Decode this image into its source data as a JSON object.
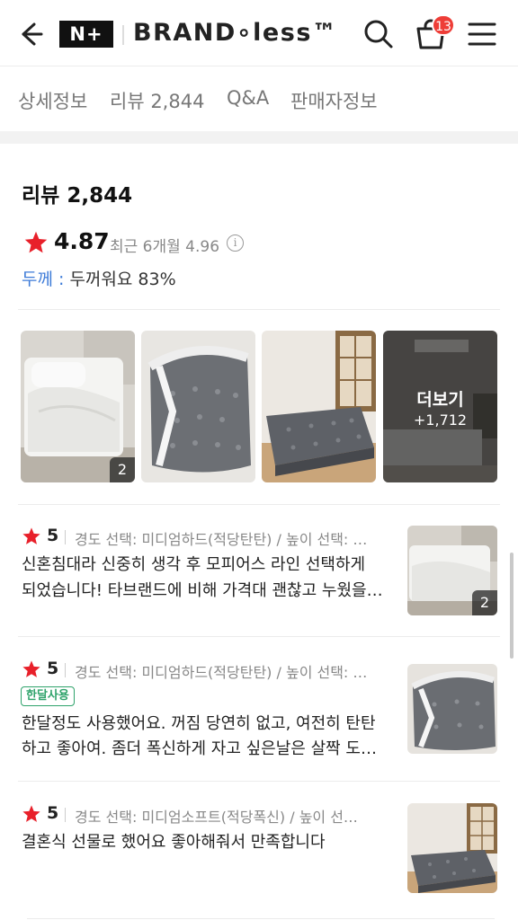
{
  "header": {
    "logo_text": "N+",
    "brand": "BRAND∘less™",
    "cart_count": "13"
  },
  "tabs": [
    "상세정보",
    "리뷰 2,844",
    "Q&A",
    "판매자정보"
  ],
  "summary": {
    "title": "리뷰 2,844",
    "rating": "4.87",
    "recent_label": "최근 6개월 4.96",
    "thickness_key": "두께 :",
    "thickness_value": "두꺼워요 83%",
    "star_color": "#e8202a"
  },
  "photos": [
    {
      "count": "2"
    },
    {
      "count": ""
    },
    {
      "count": ""
    },
    {
      "more_label": "더보기",
      "more_count": "+1,712"
    }
  ],
  "reviews": [
    {
      "score": "5",
      "option": "경도 선택: 미디엄하드(적당탄탄) / 높이 선택: …",
      "badge": "",
      "line1": "신혼침대라 신중히 생각 후 모피어스 라인 선택하게",
      "line2": "되었습니다! 타브랜드에 비해 가격대 괜찮고 누웠을…",
      "thumb_count": "2"
    },
    {
      "score": "5",
      "option": "경도 선택: 미디엄하드(적당탄탄) / 높이 선택: …",
      "badge": "한달사용",
      "line1": "한달정도 사용했어요. 꺼짐 당연히 없고, 여전히 탄탄",
      "line2": "하고 좋아여. 좀더 폭신하게 자고 싶은날은 살짝 도…",
      "thumb_count": ""
    },
    {
      "score": "5",
      "option": "경도 선택: 미디엄소프트(적당폭신) / 높이 선…",
      "badge": "",
      "line1": "결혼식 선물로 했어요 좋아해줘서 만족합니다",
      "line2": "",
      "thumb_count": ""
    }
  ]
}
